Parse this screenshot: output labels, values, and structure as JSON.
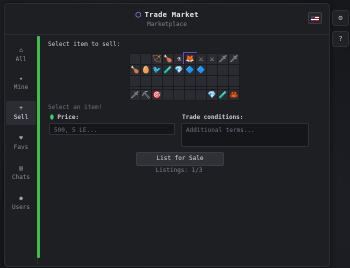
{
  "header": {
    "title": "Trade Market",
    "subtitle": "Marketplace",
    "title_icon": "shield-icon"
  },
  "sidebar": {
    "items": [
      {
        "icon": "home-icon",
        "label": "All",
        "active": false
      },
      {
        "icon": "star-icon",
        "label": "Mine",
        "active": false
      },
      {
        "icon": "plus-icon",
        "label": "Sell",
        "active": true
      },
      {
        "icon": "heart-icon",
        "label": "Favs",
        "active": false
      },
      {
        "icon": "chat-icon",
        "label": "Chats",
        "active": false
      },
      {
        "icon": "users-icon",
        "label": "Users",
        "active": false
      }
    ]
  },
  "sell": {
    "prompt": "Select item to sell:",
    "inventory_rows": [
      [
        "",
        "",
        "🏹",
        "🍗",
        "⚗",
        "🦊",
        "⚔",
        "⚔",
        "🗡",
        "🗡"
      ],
      [
        "🍗",
        "🥚",
        "🐦",
        "🧪",
        "💎",
        "🔷",
        "🔷",
        "",
        "",
        ""
      ],
      [
        "",
        "",
        "",
        "",
        "",
        "",
        "",
        "",
        "",
        ""
      ],
      [
        "",
        "",
        "",
        "",
        "",
        "",
        "",
        "",
        "",
        ""
      ]
    ],
    "hotbar": [
      "🗡",
      "⛏",
      "🎯",
      "",
      "",
      "",
      "",
      "💎",
      "🧪",
      "🦀"
    ],
    "select_item_hint": "Select an item!",
    "price_label": "Price:",
    "price_placeholder": "500, 5 LE...",
    "conditions_label": "Trade conditions:",
    "conditions_placeholder": "Additional terms...",
    "submit_label": "List for Sale",
    "listings_text": "Listings: 1/3"
  },
  "colors": {
    "accent": "#3fbf49",
    "selected_outline": "#6a4bc4",
    "price_icon": "#39d36a"
  },
  "rightbar": {
    "buttons": [
      {
        "icon": "settings-icon",
        "glyph": "⚙"
      },
      {
        "icon": "help-icon",
        "glyph": "?"
      }
    ]
  },
  "header_flag": "us-flag-icon"
}
